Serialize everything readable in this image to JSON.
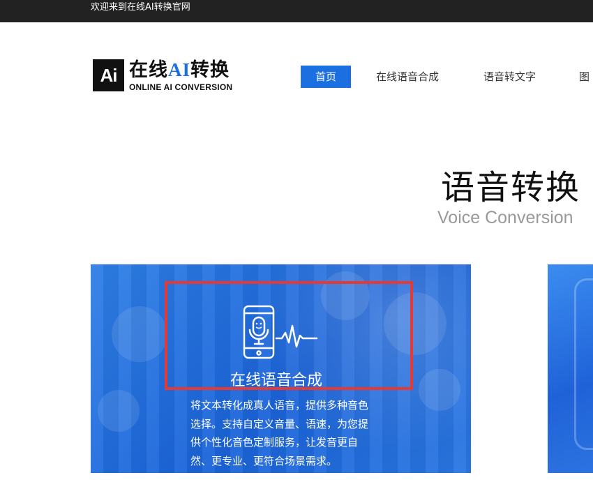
{
  "topbar": {
    "welcome_text": "欢迎来到在线AI转换官网"
  },
  "logo": {
    "mark_text": "Ai",
    "cn_prefix": "在线",
    "cn_accent": "AI",
    "cn_suffix": "转换",
    "en_text": "ONLINE AI CONVERSION",
    "accent_color": "#1c6fe0"
  },
  "nav": {
    "items": [
      {
        "label": "首页",
        "active": true
      },
      {
        "label": "在线语音合成",
        "active": false
      },
      {
        "label": "语音转文字",
        "active": false
      },
      {
        "label": "图",
        "active": false
      }
    ]
  },
  "section": {
    "title": "语音转换",
    "subtitle": "Voice Conversion"
  },
  "cards": [
    {
      "icon": "phone-microphone-waveform-icon",
      "title": "在线语音合成",
      "description": "将文本转化成真人语音，提供多种音色选择。支持自定义音量、语速，为您提供个性化音色定制服务，让发音更自然、更专业、更符合场景需求。"
    }
  ],
  "colors": {
    "topbar_bg": "#222222",
    "primary_blue": "#1c6fe0",
    "highlight_red": "#e53935"
  }
}
